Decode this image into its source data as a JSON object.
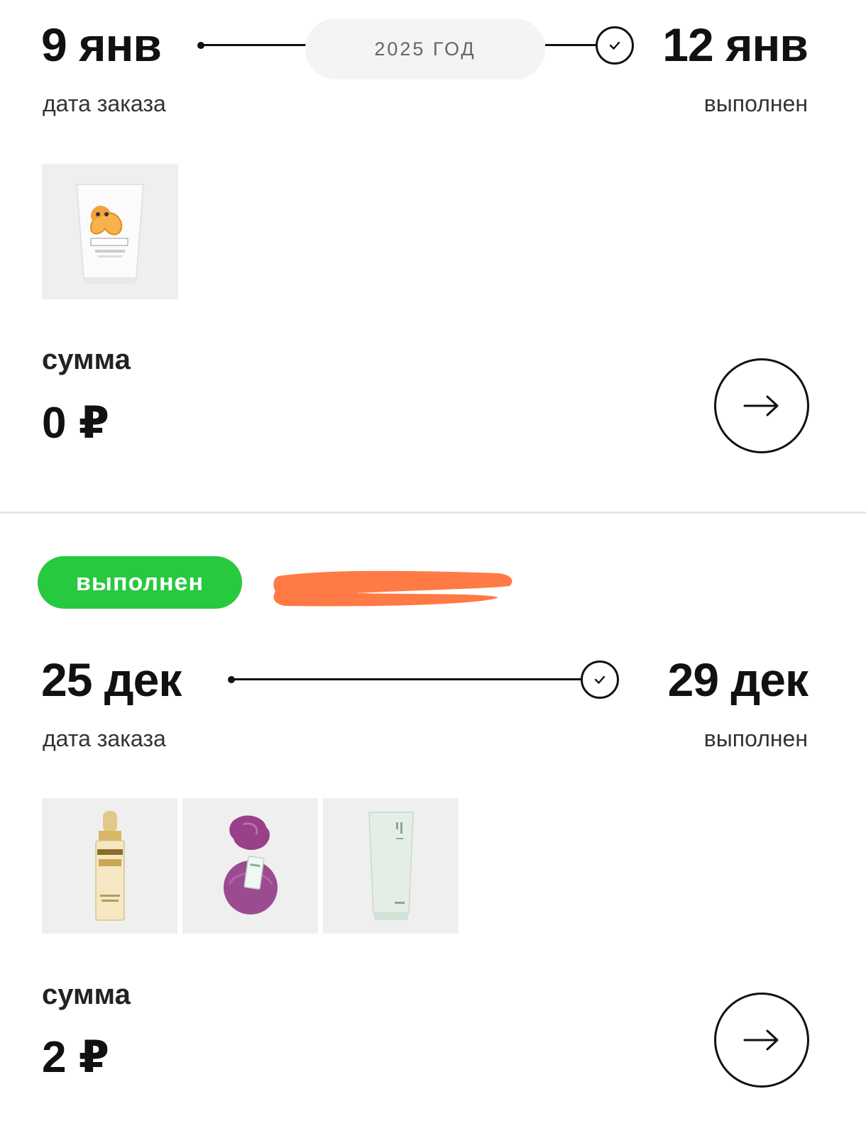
{
  "colors": {
    "accent_green": "#27c93f",
    "redaction_orange": "#ff7a45",
    "text": "#111111"
  },
  "orders": [
    {
      "start_date": "9 янв",
      "start_label": "дата заказа",
      "year": "2025 ГОД",
      "end_date": "12 янв",
      "end_label": "выполнен",
      "sum_label": "сумма",
      "sum_value": "0 ₽",
      "products": [
        {
          "name": "hair-mask-tube-product",
          "icon": "cream-tube-icon"
        }
      ]
    },
    {
      "status_badge": "выполнен",
      "order_number_redacted": true,
      "start_date": "25 дек",
      "start_label": "дата заказа",
      "end_date": "29 дек",
      "end_label": "выполнен",
      "sum_label": "сумма",
      "sum_value": "2 ₽",
      "products": [
        {
          "name": "serum-bottle-product",
          "icon": "serum-bottle-icon"
        },
        {
          "name": "bath-bomb-product",
          "icon": "bath-bomb-icon"
        },
        {
          "name": "cleanser-tube-product",
          "icon": "cream-tube-icon"
        }
      ]
    }
  ]
}
